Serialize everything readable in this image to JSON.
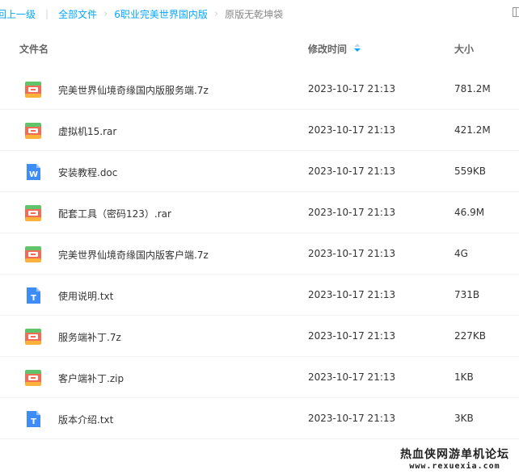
{
  "breadcrumb": {
    "back": "返回上一级",
    "back_visible": "回上一级",
    "all_files": "全部文件",
    "folder": "6职业完美世界国内版",
    "current": "原版无乾坤袋"
  },
  "columns": {
    "name": "文件名",
    "modified": "修改时间",
    "size": "大小"
  },
  "colors": {
    "accent": "#06a7ff",
    "archive_icon": "#f3654e",
    "doc_icon": "#3e8cf8",
    "txt_icon": "#3e8cf8"
  },
  "files": [
    {
      "icon": "archive-icon",
      "name": "完美世界仙境奇缘国内版服务端.7z",
      "modified": "2023-10-17 21:13",
      "size": "781.2M"
    },
    {
      "icon": "archive-icon",
      "name": "虚拟机15.rar",
      "modified": "2023-10-17 21:13",
      "size": "421.2M"
    },
    {
      "icon": "word-doc-icon",
      "name": "安装教程.doc",
      "modified": "2023-10-17 21:13",
      "size": "559KB"
    },
    {
      "icon": "archive-icon",
      "name": "配套工具（密码123）.rar",
      "modified": "2023-10-17 21:13",
      "size": "46.9M"
    },
    {
      "icon": "archive-icon",
      "name": "完美世界仙境奇缘国内版客户端.7z",
      "modified": "2023-10-17 21:13",
      "size": "4G"
    },
    {
      "icon": "text-file-icon",
      "name": "使用说明.txt",
      "modified": "2023-10-17 21:13",
      "size": "731B"
    },
    {
      "icon": "archive-icon",
      "name": "服务端补丁.7z",
      "modified": "2023-10-17 21:13",
      "size": "227KB"
    },
    {
      "icon": "archive-icon",
      "name": "客户端补丁.zip",
      "modified": "2023-10-17 21:13",
      "size": "1KB"
    },
    {
      "icon": "text-file-icon",
      "name": "版本介绍.txt",
      "modified": "2023-10-17 21:13",
      "size": "3KB"
    }
  ],
  "watermark": {
    "line1": "热血侠网游单机论坛",
    "line2": "www.rexuexia.com"
  }
}
